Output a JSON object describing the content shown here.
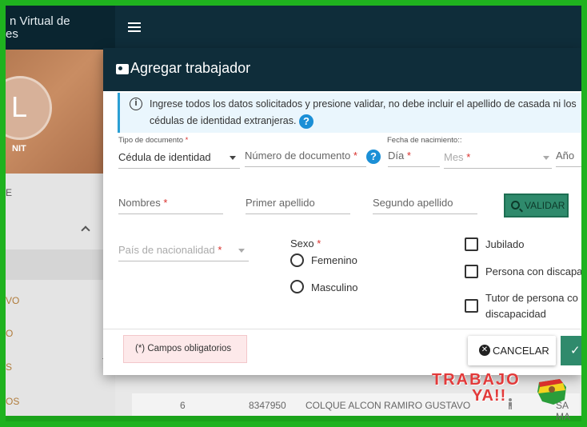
{
  "app": {
    "title_fragment": "n Virtual de",
    "title_fragment2": "es"
  },
  "sidebar": {
    "avatar_initial": "L",
    "nit_label": "NIT",
    "items": [
      "E",
      "VO",
      "O",
      "S",
      "OS"
    ]
  },
  "table_row": {
    "number": "6",
    "doc": "8347950",
    "name": "COLQUE ALCON RAMIRO GUSTAVO",
    "tail": "SA MA"
  },
  "watermark": {
    "line1": "TRABAJO",
    "line2": "YA!!"
  },
  "modal": {
    "title": "Agregar trabajador",
    "info_text": "Ingrese todos los datos solicitados y presione validar, no debe incluir el apellido de casada ni los",
    "info_text2": "cédulas de identidad extranjeras.",
    "help_icon": "?",
    "tipo_documento_label": "Tipo de documento",
    "tipo_documento_value": "Cédula de identidad",
    "numero_documento_placeholder": "Número de documento",
    "fecha_nacimiento_label": "Fecha de nacimiento::",
    "dia_placeholder": "Día",
    "mes_placeholder": "Mes",
    "anio_placeholder": "Año",
    "nombres_placeholder": "Nombres",
    "primer_apellido_placeholder": "Primer apellido",
    "segundo_apellido_placeholder": "Segundo apellido",
    "validar_label": "VALIDAR",
    "pais_placeholder": "País de nacionalidad",
    "sexo_label": "Sexo",
    "femenino_label": "Femenino",
    "masculino_label": "Masculino",
    "jubilado_label": "Jubilado",
    "discapacidad_label": "Persona con discapac",
    "tutor_label": "Tutor de persona co",
    "tutor_label2": "discapacidad",
    "required_mark": "*",
    "campos_obligatorios": "(*) Campos obligatorios",
    "cancel_label": "CANCELAR",
    "ok_icon": "✓"
  },
  "colors": {
    "header": "#0f2d3a",
    "accent": "#2f8a6c",
    "info_bg": "#eaf6fd",
    "frame": "#1fb21f"
  }
}
